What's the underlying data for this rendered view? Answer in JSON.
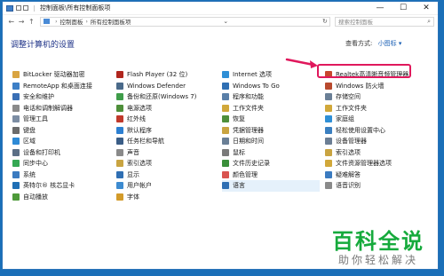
{
  "window": {
    "title": "控制面板\\所有控制面板项",
    "min": "—",
    "max": "☐",
    "close": "✕"
  },
  "address": {
    "back": "←",
    "forward": "→",
    "up": "↑",
    "crumbs": [
      "控制面板",
      "所有控制面板项"
    ],
    "dropdown": "⌄",
    "refresh": "↻",
    "search_placeholder": "搜索控制面板"
  },
  "heading": "调整计算机的设置",
  "view_by": {
    "label": "查看方式:",
    "value": "小图标 ▾"
  },
  "columns": [
    [
      {
        "label": "BitLocker 驱动器加密",
        "color": "#d9a441"
      },
      {
        "label": "RemoteApp 和桌面连接",
        "color": "#3d7fc6"
      },
      {
        "label": "安全和维护",
        "color": "#3a6fb5"
      },
      {
        "label": "电话和调制解调器",
        "color": "#8a8a8a"
      },
      {
        "label": "管理工具",
        "color": "#7c8da3"
      },
      {
        "label": "键盘",
        "color": "#6b6b6b"
      },
      {
        "label": "区域",
        "color": "#2e8ad6"
      },
      {
        "label": "设备和打印机",
        "color": "#5b6f86"
      },
      {
        "label": "同步中心",
        "color": "#35a853"
      },
      {
        "label": "系统",
        "color": "#3b7bc0"
      },
      {
        "label": "英特尔® 核芯显卡",
        "color": "#1f6fb5"
      },
      {
        "label": "自动播放",
        "color": "#4e9a3a"
      }
    ],
    [
      {
        "label": "Flash Player (32 位)",
        "color": "#b0261e"
      },
      {
        "label": "Windows Defender",
        "color": "#4a6a8a"
      },
      {
        "label": "备份和还原(Windows 7)",
        "color": "#3f9d4a"
      },
      {
        "label": "电源选项",
        "color": "#4e8f3a"
      },
      {
        "label": "红外线",
        "color": "#c0392b"
      },
      {
        "label": "默认程序",
        "color": "#2c7fd1"
      },
      {
        "label": "任务栏和导航",
        "color": "#3a5d86"
      },
      {
        "label": "声音",
        "color": "#8a8a8a"
      },
      {
        "label": "索引选项",
        "color": "#c9a441"
      },
      {
        "label": "显示",
        "color": "#2f6fb3"
      },
      {
        "label": "用户帐户",
        "color": "#3d8bd0"
      },
      {
        "label": "字体",
        "color": "#d39b2a"
      }
    ],
    [
      {
        "label": "Internet 选项",
        "color": "#2f8fd6"
      },
      {
        "label": "Windows To Go",
        "color": "#2f6fb3"
      },
      {
        "label": "程序和功能",
        "color": "#5a7fa8"
      },
      {
        "label": "工作文件夹",
        "color": "#d1a83a"
      },
      {
        "label": "恢复",
        "color": "#4e8f3a"
      },
      {
        "label": "凭据管理器",
        "color": "#c9a441"
      },
      {
        "label": "日期和时间",
        "color": "#6a7f96"
      },
      {
        "label": "鼠标",
        "color": "#7a7a7a"
      },
      {
        "label": "文件历史记录",
        "color": "#3a8f3a"
      },
      {
        "label": "颜色管理",
        "color": "#d9534f"
      },
      {
        "label": "语言",
        "color": "#2f6fb3"
      }
    ],
    [
      {
        "label": "Realtek高清晰音频管理器",
        "color": "#c8472e"
      },
      {
        "label": "Windows 防火墙",
        "color": "#b84a2e"
      },
      {
        "label": "存储空间",
        "color": "#6a7f96"
      },
      {
        "label": "工作文件夹",
        "color": "#d1a83a"
      },
      {
        "label": "家庭组",
        "color": "#2f8fd6"
      },
      {
        "label": "轻松使用设置中心",
        "color": "#3a7fc0"
      },
      {
        "label": "设备管理器",
        "color": "#6b7e94"
      },
      {
        "label": "索引选项",
        "color": "#c9a441"
      },
      {
        "label": "文件资源管理器选项",
        "color": "#d1a83a"
      },
      {
        "label": "疑难解答",
        "color": "#3b7bc0"
      },
      {
        "label": "语音识别",
        "color": "#8a8a8a"
      }
    ]
  ],
  "watermark": {
    "title": "百科全说",
    "subtitle": "助你轻松解决"
  }
}
